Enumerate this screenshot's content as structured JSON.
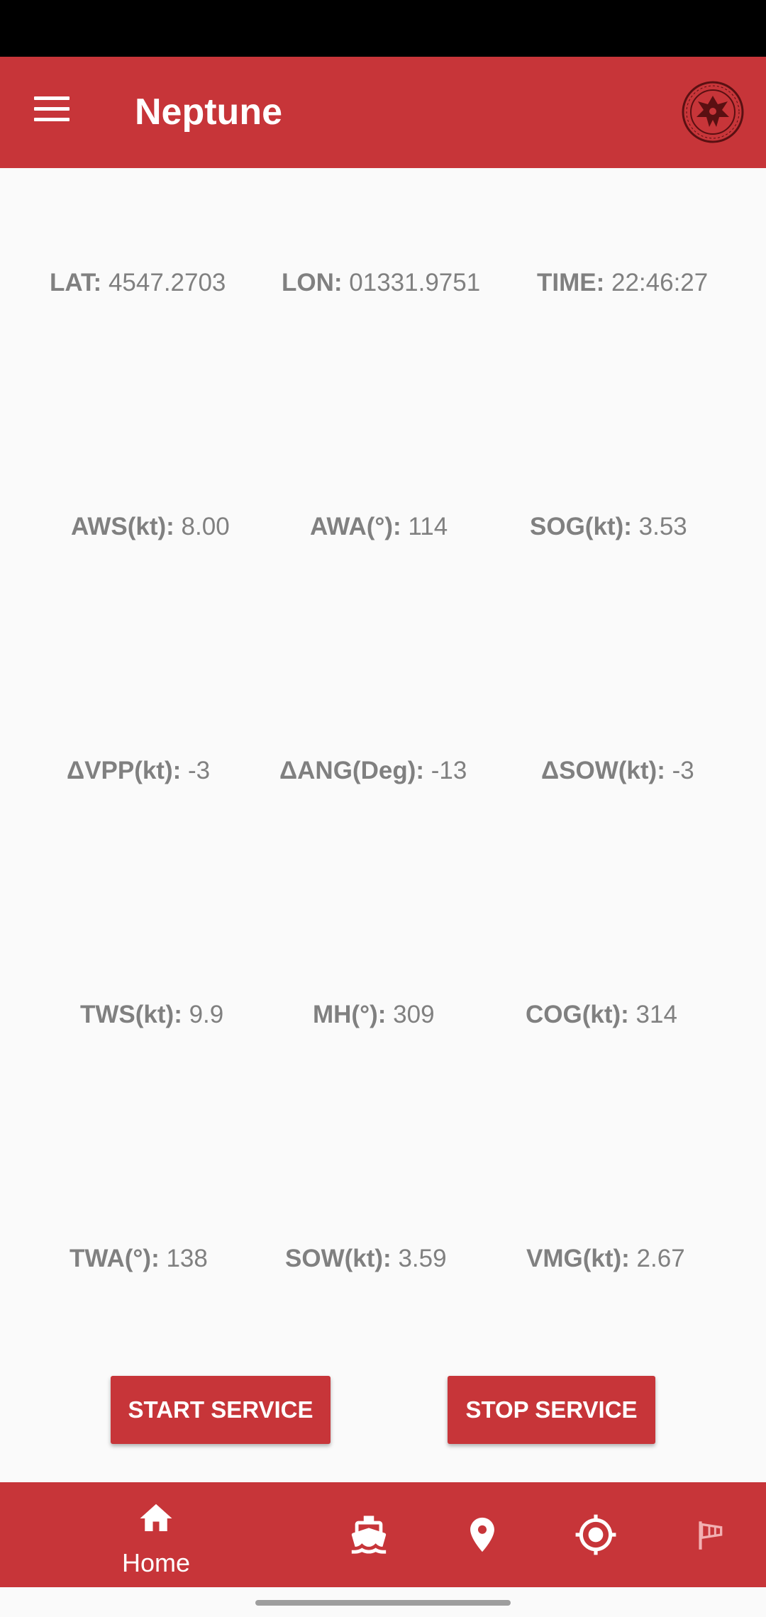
{
  "app_bar": {
    "title": "Neptune",
    "menu_icon": "menu-icon",
    "logo_icon": "university-seal-icon"
  },
  "readings": [
    {
      "label": "LAT:",
      "value": "4547.2703"
    },
    {
      "label": "LON:",
      "value": "01331.9751"
    },
    {
      "label": "TIME:",
      "value": "22:46:27"
    },
    {
      "label": "AWS(kt):",
      "value": "8.00"
    },
    {
      "label": "AWA(°):",
      "value": "114"
    },
    {
      "label": "SOG(kt):",
      "value": "3.53"
    },
    {
      "label": "ΔVPP(kt):",
      "value": "-3"
    },
    {
      "label": "ΔANG(Deg):",
      "value": "-13"
    },
    {
      "label": "ΔSOW(kt):",
      "value": "-3"
    },
    {
      "label": "TWS(kt):",
      "value": "9.9"
    },
    {
      "label": "MH(°):",
      "value": "309"
    },
    {
      "label": "COG(kt):",
      "value": "314"
    },
    {
      "label": "TWA(°):",
      "value": "138"
    },
    {
      "label": "SOW(kt):",
      "value": "3.59"
    },
    {
      "label": "VMG(kt):",
      "value": "2.67"
    }
  ],
  "actions": {
    "start_label": "START SERVICE",
    "stop_label": "STOP SERVICE"
  },
  "bottom_nav": {
    "items": [
      {
        "label": "Home",
        "icon": "home-icon",
        "selected": true
      },
      {
        "label": "",
        "icon": "boat-icon",
        "selected": false
      },
      {
        "label": "",
        "icon": "location-pin-icon",
        "selected": false
      },
      {
        "label": "",
        "icon": "gps-target-icon",
        "selected": false
      },
      {
        "label": "",
        "icon": "windsock-icon",
        "selected": false
      }
    ]
  },
  "colors": {
    "primary": "#c73539",
    "background": "#fafafa",
    "text_gray": "#808080",
    "status_bar": "#000000"
  }
}
